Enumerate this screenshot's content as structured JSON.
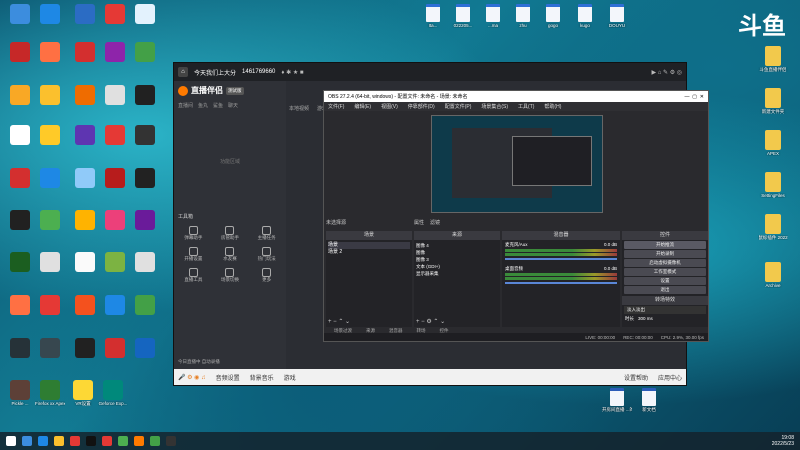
{
  "desktop": {
    "left_icons": [
      [
        "",
        "",
        "",
        "",
        "",
        ""
      ],
      [
        "",
        "",
        "",
        "",
        "",
        ""
      ]
    ],
    "top_files": [
      {
        "label": "Ita..."
      },
      {
        "label": "022205..."
      },
      {
        "label": "...ma"
      },
      {
        "label": "zhu"
      },
      {
        "label": "gogo"
      },
      {
        "label": "kugo"
      },
      {
        "label": "DOUYU"
      }
    ],
    "right_icons": [
      {
        "label": "斗鱼直播伴侣"
      },
      {
        "label": "新建文件夹"
      },
      {
        "label": "APEX"
      },
      {
        "label": "SettingFiles"
      },
      {
        "label": "鼠标插件 2022"
      },
      {
        "label": "Archive"
      }
    ],
    "bottom_docs": [
      {
        "label": "开房间直播 ...的认识"
      },
      {
        "label": "新文档"
      }
    ],
    "bottom_left_labels": [
      "Pickle ...",
      "Firefox xx Apex ...",
      "VR设置",
      "Geforce Exp..."
    ]
  },
  "douyu": {
    "title_text": "今天我们上大分",
    "room_id": "1461769660",
    "logo_text": "直播伴侣",
    "version_badge": "测试版",
    "side_tabs": [
      "直播间",
      "鱼丸",
      "鲨鱼",
      "聊天"
    ],
    "side_hint": "功能区域",
    "tools_title": "工具箱",
    "tools": [
      {
        "label": "弹幕助手"
      },
      {
        "label": "房管助手"
      },
      {
        "label": "主播任务"
      },
      {
        "label": "开播设置"
      },
      {
        "label": "水友赛"
      },
      {
        "label": "热门玩法"
      },
      {
        "label": "直播工具"
      },
      {
        "label": "场景切换"
      },
      {
        "label": "更多"
      }
    ],
    "status_text": "今日直播中 自动录播",
    "bottom_tools": [
      "音频设置",
      "背景音乐",
      "游戏"
    ],
    "bottom_right": [
      "设置帮助",
      "应用中心"
    ],
    "right_tabs": [
      "本地视频",
      "游戏"
    ]
  },
  "obs": {
    "title": "OBS 27.2.4 (64-bit, windows) - 配置文件: 未命名 - 场景: 未命名",
    "menu": [
      "文件(F)",
      "编辑(E)",
      "视图(V)",
      "停靠部件(D)",
      "配置文件(P)",
      "场景集合(S)",
      "工具(T)",
      "帮助(H)"
    ],
    "no_source": "未选择源",
    "prop_btns": [
      "属性",
      "滤镜"
    ],
    "docks": {
      "scenes_title": "场景",
      "sources_title": "来源",
      "mixer_title": "混音器",
      "controls_title": "控件"
    },
    "scenes": [
      "场景",
      "场景 2"
    ],
    "sources": [
      "图像 4",
      "图像",
      "图像 3",
      "文本 (GDI+)",
      "显示器采集"
    ],
    "mixer": [
      {
        "name": "麦克风/Aux",
        "db": "0.0 dB"
      },
      {
        "name": "桌面音频",
        "db": "0.0 dB"
      }
    ],
    "controls": [
      "开始推流",
      "开始录制",
      "启动虚拟摄像机",
      "工作室模式",
      "设置",
      "退出"
    ],
    "transition_title": "转场特效",
    "transition": "淡入淡出",
    "duration_label": "时长",
    "duration": "300 ms",
    "bottom_tabs": [
      "场景过渡",
      "来源",
      "混音器",
      "转场",
      "控件"
    ],
    "status": {
      "live": "LIVE: 00:00:00",
      "rec": "REC: 00:00:00",
      "cpu": "CPU: 2.9%, 30.00 fps"
    }
  },
  "taskbar": {
    "time": "19:08",
    "date": "2022/5/23"
  },
  "watermark": "斗鱼"
}
